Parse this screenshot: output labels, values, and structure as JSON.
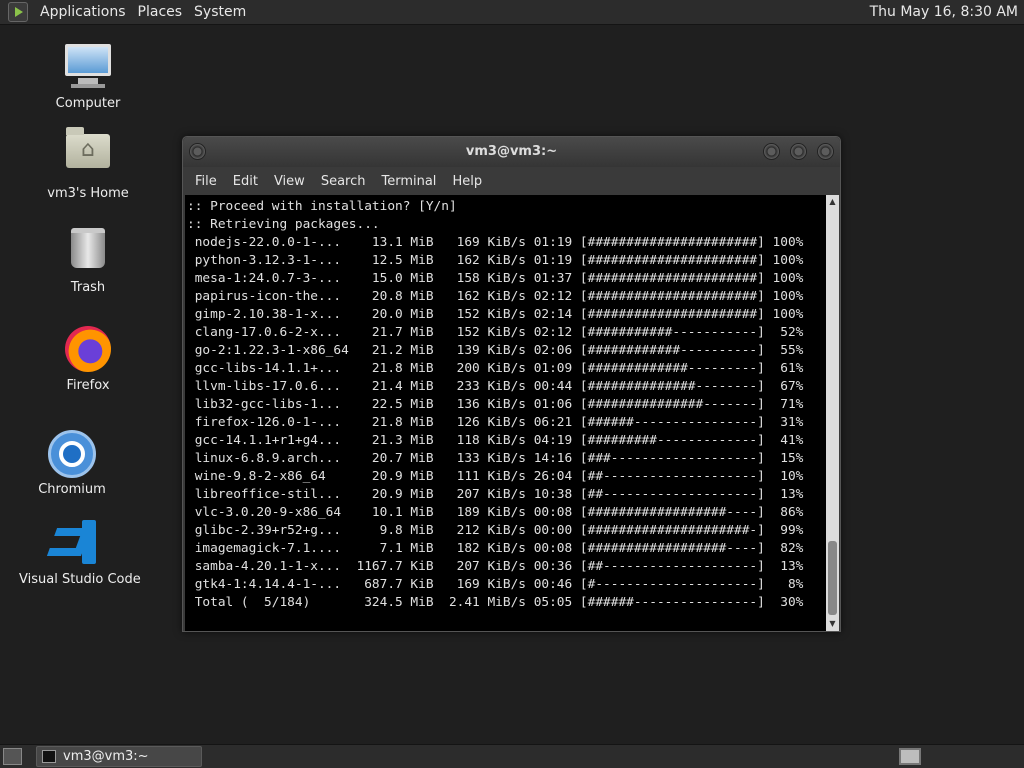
{
  "top_panel": {
    "menu": [
      "Applications",
      "Places",
      "System"
    ],
    "clock": "Thu May 16,  8:30 AM"
  },
  "desktop": {
    "icons": [
      {
        "label": "Computer",
        "icon": "computer-icon"
      },
      {
        "label": "vm3's Home",
        "icon": "home-folder-icon"
      },
      {
        "label": "Trash",
        "icon": "trash-icon"
      },
      {
        "label": "Firefox",
        "icon": "firefox-icon"
      },
      {
        "label": "Chromium",
        "icon": "chromium-icon"
      },
      {
        "label": "Visual Studio Code",
        "icon": "vscode-icon"
      }
    ]
  },
  "terminal": {
    "title": "vm3@vm3:~",
    "menu": [
      "File",
      "Edit",
      "View",
      "Search",
      "Terminal",
      "Help"
    ],
    "lines": [
      ":: Proceed with installation? [Y/n]",
      ":: Retrieving packages...",
      " nodejs-22.0.0-1-...    13.1 MiB   169 KiB/s 01:19 [######################] 100%",
      " python-3.12.3-1-...    12.5 MiB   162 KiB/s 01:19 [######################] 100%",
      " mesa-1:24.0.7-3-...    15.0 MiB   158 KiB/s 01:37 [######################] 100%",
      " papirus-icon-the...    20.8 MiB   162 KiB/s 02:12 [######################] 100%",
      " gimp-2.10.38-1-x...    20.0 MiB   152 KiB/s 02:14 [######################] 100%",
      " clang-17.0.6-2-x...    21.7 MiB   152 KiB/s 02:12 [###########-----------]  52%",
      " go-2:1.22.3-1-x86_64   21.2 MiB   139 KiB/s 02:06 [############----------]  55%",
      " gcc-libs-14.1.1+...    21.8 MiB   200 KiB/s 01:09 [#############---------]  61%",
      " llvm-libs-17.0.6...    21.4 MiB   233 KiB/s 00:44 [##############--------]  67%",
      " lib32-gcc-libs-1...    22.5 MiB   136 KiB/s 01:06 [###############-------]  71%",
      " firefox-126.0-1-...    21.8 MiB   126 KiB/s 06:21 [######----------------]  31%",
      " gcc-14.1.1+r1+g4...    21.3 MiB   118 KiB/s 04:19 [#########-------------]  41%",
      " linux-6.8.9.arch...    20.7 MiB   133 KiB/s 14:16 [###-------------------]  15%",
      " wine-9.8-2-x86_64      20.9 MiB   111 KiB/s 26:04 [##--------------------]  10%",
      " libreoffice-stil...    20.9 MiB   207 KiB/s 10:38 [##--------------------]  13%",
      " vlc-3.0.20-9-x86_64    10.1 MiB   189 KiB/s 00:08 [##################----]  86%",
      " glibc-2.39+r52+g...     9.8 MiB   212 KiB/s 00:00 [#####################-]  99%",
      " imagemagick-7.1....     7.1 MiB   182 KiB/s 00:08 [##################----]  82%",
      " samba-4.20.1-1-x...  1167.7 KiB   207 KiB/s 00:36 [##--------------------]  13%",
      " gtk4-1:4.14.4-1-...   687.7 KiB   169 KiB/s 00:46 [#---------------------]   8%",
      " Total (  5/184)       324.5 MiB  2.41 MiB/s 05:05 [######----------------]  30%"
    ]
  },
  "taskbar": {
    "task_label": "vm3@vm3:~"
  }
}
